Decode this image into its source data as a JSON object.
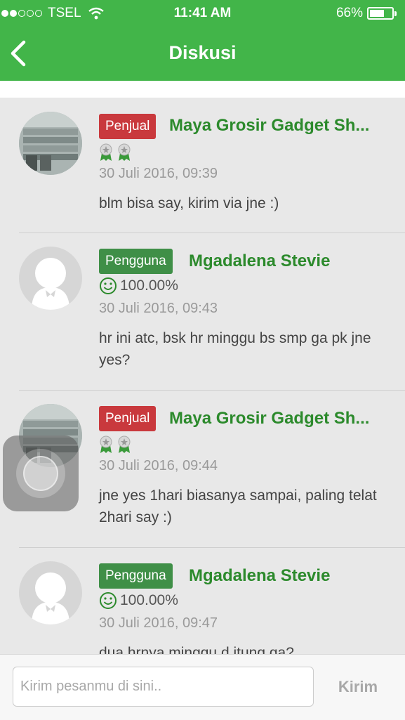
{
  "status_bar": {
    "carrier": "TSEL",
    "time": "11:41 AM",
    "battery": "66%",
    "battery_level": 0.66
  },
  "header": {
    "title": "Diskusi",
    "back_icon": "chevron-left-icon"
  },
  "messages": [
    {
      "role": "Penjual",
      "name": "Maya Grosir Gadget Sh...",
      "rating": "",
      "date": "30 Juli 2016, 09:39",
      "text": "blm bisa say, kirim via jne  :)"
    },
    {
      "role": "Pengguna",
      "name": "Mgadalena Stevie",
      "rating": "100.00%",
      "date": "30 Juli 2016, 09:43",
      "text": "hr ini atc, bsk hr minggu bs smp ga pk jne yes?"
    },
    {
      "role": "Penjual",
      "name": "Maya Grosir Gadget Sh...",
      "rating": "",
      "date": "30 Juli 2016, 09:44",
      "text": "jne yes 1hari biasanya sampai, paling telat 2hari say :)"
    },
    {
      "role": "Pengguna",
      "name": "Mgadalena Stevie",
      "rating": "100.00%",
      "date": "30 Juli 2016, 09:47",
      "text": "dua hrnya minggu d itung ga?"
    }
  ],
  "composer": {
    "placeholder": "Kirim pesanmu di sini..",
    "send_label": "Kirim"
  },
  "colors": {
    "brand_green": "#42b549",
    "seller_badge": "#c9393d",
    "user_badge": "#3f8f47",
    "name_green": "#2c8a2c"
  }
}
